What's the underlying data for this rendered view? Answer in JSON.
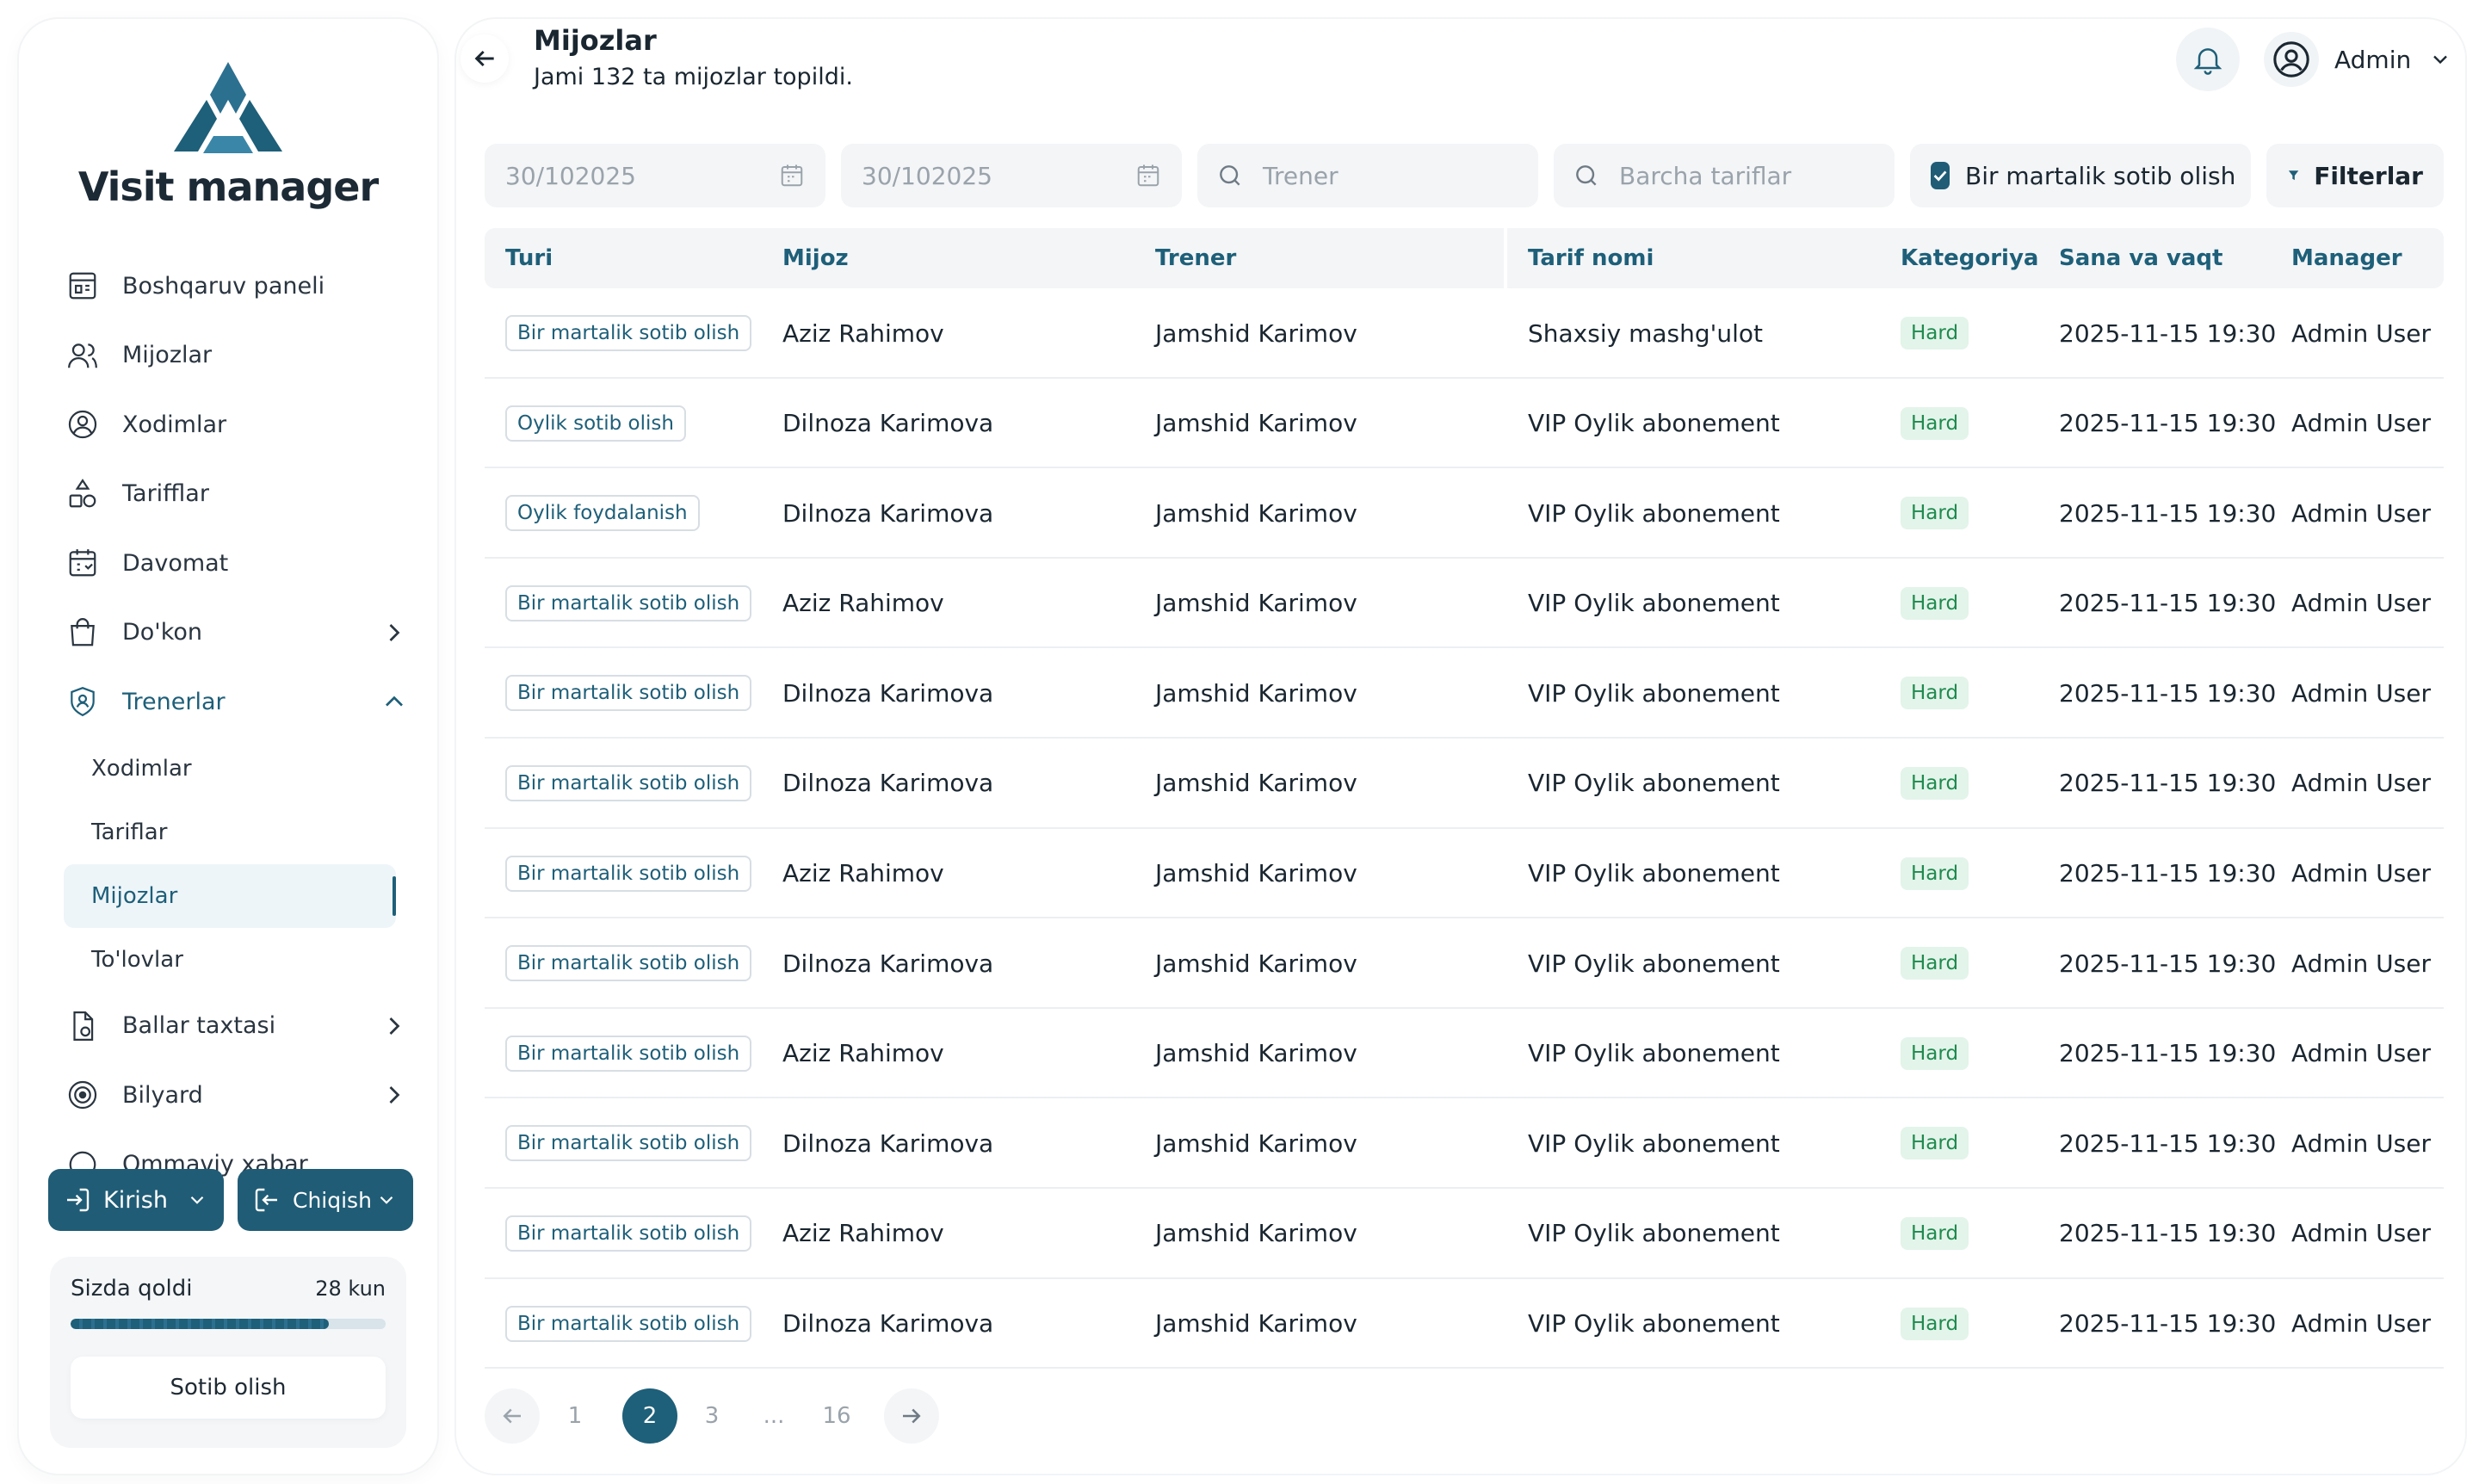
{
  "brand": {
    "name": "Visit manager"
  },
  "colors": {
    "primary": "#1e5f79",
    "badge_green": "#1f8a4e",
    "field_bg": "#f3f5f7"
  },
  "sidebar": {
    "items": [
      {
        "label": "Boshqaruv paneli",
        "icon": "dashboard-icon"
      },
      {
        "label": "Mijozlar",
        "icon": "users-icon"
      },
      {
        "label": "Xodimlar",
        "icon": "staff-icon"
      },
      {
        "label": "Tarifflar",
        "icon": "shapes-icon"
      },
      {
        "label": "Davomat",
        "icon": "calendar-icon"
      },
      {
        "label": "Do'kon",
        "icon": "shopping-bag-icon"
      },
      {
        "label": "Trenerlar",
        "icon": "shield-user-icon"
      },
      {
        "label": "Ballar taxtasi",
        "icon": "document-icon"
      },
      {
        "label": "Bilyard",
        "icon": "target-icon"
      },
      {
        "label": "Ommaviy xabar",
        "icon": "chat-icon"
      }
    ],
    "sub_items": [
      "Xodimlar",
      "Tariflar",
      "Mijozlar",
      "To'lovlar"
    ],
    "kirish_label": "Kirish",
    "chiqish_label": "Chiqish",
    "subscription": {
      "label": "Sizda qoldi",
      "days": "28 kun",
      "progress": 0.82,
      "buy_label": "Sotib olish"
    }
  },
  "header": {
    "title": "Mijozlar",
    "subtitle": "Jami 132 ta mijozlar topildi.",
    "user_name": "Admin"
  },
  "filters": {
    "date_from_placeholder": "30/102025",
    "date_to_placeholder": "30/102025",
    "trainer_placeholder": "Trener",
    "tariff_placeholder": "Barcha tariflar",
    "one_time_label": "Bir martalik sotib olish",
    "filters_label": "Filterlar"
  },
  "table": {
    "headers": [
      "Turi",
      "Mijoz",
      "Trener",
      "Tarif nomi",
      "Kategoriya",
      "Sana va vaqt",
      "Manager"
    ],
    "rows": [
      [
        "Bir martalik sotib olish",
        "Aziz Rahimov",
        "Jamshid Karimov",
        "Shaxsiy mashg'ulot",
        "Hard",
        "2025-11-15 19:30",
        "Admin User"
      ],
      [
        "Oylik sotib olish",
        "Dilnoza Karimova",
        "Jamshid Karimov",
        "VIP Oylik abonement",
        "Hard",
        "2025-11-15 19:30",
        "Admin User"
      ],
      [
        "Oylik foydalanish",
        "Dilnoza Karimova",
        "Jamshid Karimov",
        "VIP Oylik abonement",
        "Hard",
        "2025-11-15 19:30",
        "Admin User"
      ],
      [
        "Bir martalik sotib olish",
        "Aziz Rahimov",
        "Jamshid Karimov",
        "VIP Oylik abonement",
        "Hard",
        "2025-11-15 19:30",
        "Admin User"
      ],
      [
        "Bir martalik sotib olish",
        "Dilnoza Karimova",
        "Jamshid Karimov",
        "VIP Oylik abonement",
        "Hard",
        "2025-11-15 19:30",
        "Admin User"
      ],
      [
        "Bir martalik sotib olish",
        "Dilnoza Karimova",
        "Jamshid Karimov",
        "VIP Oylik abonement",
        "Hard",
        "2025-11-15 19:30",
        "Admin User"
      ],
      [
        "Bir martalik sotib olish",
        "Aziz Rahimov",
        "Jamshid Karimov",
        "VIP Oylik abonement",
        "Hard",
        "2025-11-15 19:30",
        "Admin User"
      ],
      [
        "Bir martalik sotib olish",
        "Dilnoza Karimova",
        "Jamshid Karimov",
        "VIP Oylik abonement",
        "Hard",
        "2025-11-15 19:30",
        "Admin User"
      ],
      [
        "Bir martalik sotib olish",
        "Aziz Rahimov",
        "Jamshid Karimov",
        "VIP Oylik abonement",
        "Hard",
        "2025-11-15 19:30",
        "Admin User"
      ],
      [
        "Bir martalik sotib olish",
        "Dilnoza Karimova",
        "Jamshid Karimov",
        "VIP Oylik abonement",
        "Hard",
        "2025-11-15 19:30",
        "Admin User"
      ],
      [
        "Bir martalik sotib olish",
        "Aziz Rahimov",
        "Jamshid Karimov",
        "VIP Oylik abonement",
        "Hard",
        "2025-11-15 19:30",
        "Admin User"
      ],
      [
        "Bir martalik sotib olish",
        "Dilnoza Karimova",
        "Jamshid Karimov",
        "VIP Oylik abonement",
        "Hard",
        "2025-11-15 19:30",
        "Admin User"
      ]
    ]
  },
  "pagination": {
    "pages": [
      "1",
      "2",
      "3",
      "...",
      "16"
    ],
    "current": "2"
  }
}
